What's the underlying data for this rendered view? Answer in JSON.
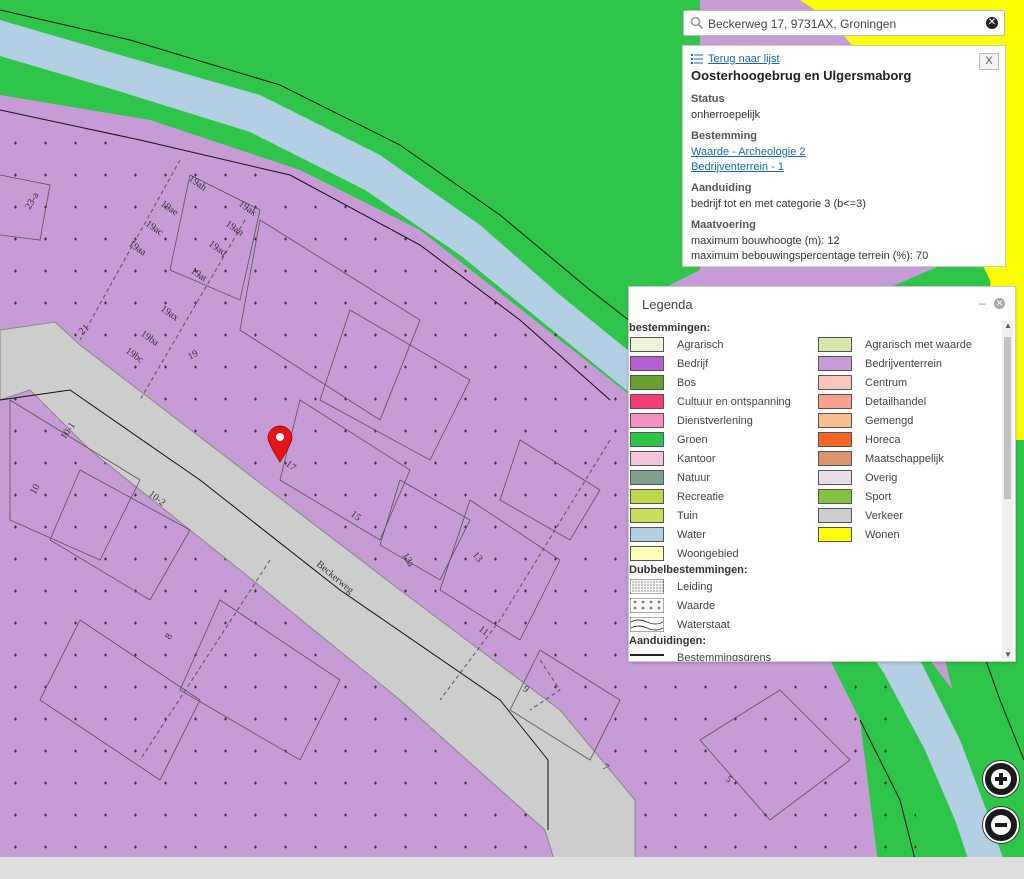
{
  "search": {
    "value": "Beckerweg 17, 9731AX, Groningen"
  },
  "info": {
    "back_link": "Terug naar lijst",
    "close_label": "X",
    "title": "Oosterhoogebrug en Ulgersmaborg",
    "status_title": "Status",
    "status_value": "onherroepelijk",
    "bestemming_title": "Bestemming",
    "bestemming_links": [
      "Waarde - Archeologie 2",
      "Bedrijventerrein - 1"
    ],
    "aanduiding_title": "Aanduiding",
    "aanduiding_value": "bedrijf tot en met categorie 3 (b<=3)",
    "maatvoering_title": "Maatvoering",
    "maatvoering_values": [
      "maximum bouwhoogte (m): 12",
      "maximum bebouwingspercentage terrein (%): 70"
    ]
  },
  "legend": {
    "title": "Legenda",
    "group_bestemmingen": "bestemmingen:",
    "bestemmingen": [
      {
        "label": "Agrarisch",
        "color": "#eef3d6"
      },
      {
        "label": "Agrarisch met waarde",
        "color": "#d6e8a8"
      },
      {
        "label": "Bedrijf",
        "color": "#b65fd1"
      },
      {
        "label": "Bedrijventerrein",
        "color": "#c79bd6"
      },
      {
        "label": "Bos",
        "color": "#67a22f"
      },
      {
        "label": "Centrum",
        "color": "#f9c5bc"
      },
      {
        "label": "Cultuur en ontspanning",
        "color": "#f23c74"
      },
      {
        "label": "Detailhandel",
        "color": "#f9a18e"
      },
      {
        "label": "Dienstverlening",
        "color": "#f190c1"
      },
      {
        "label": "Gemengd",
        "color": "#f7be8e"
      },
      {
        "label": "Groen",
        "color": "#2ec54a"
      },
      {
        "label": "Horeca",
        "color": "#f86528"
      },
      {
        "label": "Kantoor",
        "color": "#f4c4dc"
      },
      {
        "label": "Maatschappelijk",
        "color": "#da9671"
      },
      {
        "label": "Natuur",
        "color": "#7fa08e"
      },
      {
        "label": "Overig",
        "color": "#e9dde8"
      },
      {
        "label": "Recreatie",
        "color": "#bcd64a"
      },
      {
        "label": "Sport",
        "color": "#86c143"
      },
      {
        "label": "Tuin",
        "color": "#c9de5f"
      },
      {
        "label": "Verkeer",
        "color": "#cdcdcd"
      },
      {
        "label": "Water",
        "color": "#b3cfe4"
      },
      {
        "label": "Wonen",
        "color": "#fcff00"
      },
      {
        "label": "Woongebied",
        "color": "#fcffb5"
      }
    ],
    "group_dubbel": "Dubbelbestemmingen:",
    "dubbel": [
      {
        "label": "Leiding",
        "pattern": "dots"
      },
      {
        "label": "Waarde",
        "pattern": "plus"
      },
      {
        "label": "Waterstaat",
        "pattern": "wave"
      }
    ],
    "group_aanduidingen": "Aanduidingen:",
    "aanduidingen": [
      {
        "label": "Bestemmingsgrens"
      }
    ]
  },
  "map": {
    "street_label": "Beckerweg",
    "house_numbers": [
      "23-a",
      "19ah",
      "19ae",
      "19ac",
      "19aa",
      "19ak",
      "19an",
      "19aq",
      "19at",
      "19ax",
      "19ba",
      "19bc",
      "19",
      "21",
      "10-1",
      "10",
      "10-2",
      "8",
      "17",
      "15",
      "13a",
      "13",
      "11",
      "9",
      "7",
      "5"
    ]
  },
  "zoom": {
    "in": "zoom-in",
    "out": "zoom-out"
  }
}
